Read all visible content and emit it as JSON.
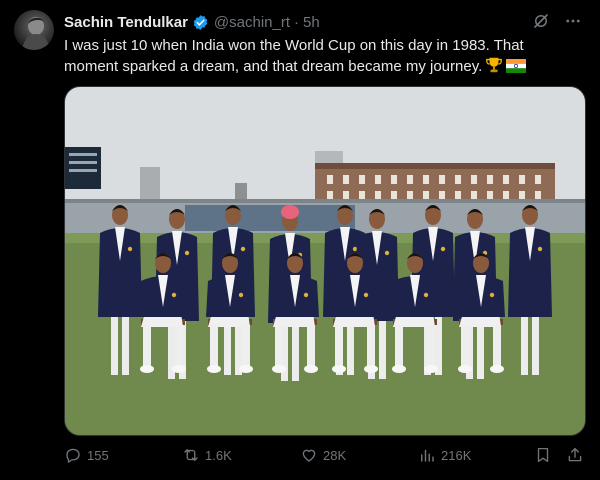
{
  "author": {
    "name": "Sachin Tendulkar",
    "handle": "@sachin_rt",
    "separator": "·",
    "time": "5h"
  },
  "tweet": {
    "text": "I was just 10 when India won the World Cup on this day in 1983. That moment sparked a dream, and that dream became my journey.",
    "emojis": [
      "trophy-emoji",
      "india-flag-emoji"
    ]
  },
  "photo": {
    "scoreboard_color": "#1c2a3a",
    "grass_color": "#6f8a4c",
    "blazer_color": "#1c2249"
  },
  "actions": {
    "replies": "155",
    "reposts": "1.6K",
    "likes": "28K",
    "views": "216K"
  },
  "colors": {
    "background": "#000000",
    "text": "#e7e9ea",
    "muted": "#71767b",
    "verified": "#1d9bf0"
  }
}
